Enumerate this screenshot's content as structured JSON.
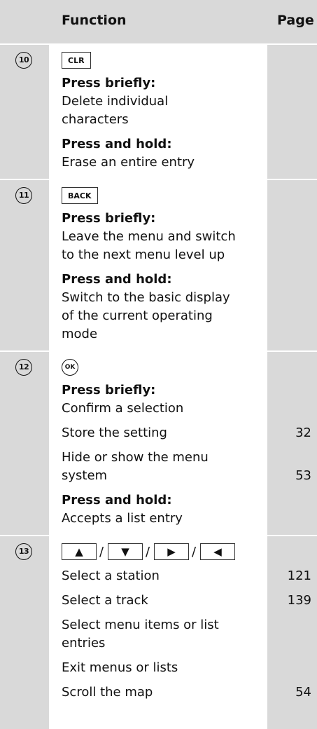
{
  "header": {
    "function": "Function",
    "page": "Page"
  },
  "rows": [
    {
      "number": "10",
      "key": "CLR",
      "press_briefly": "Press briefly:",
      "brief_l1": "Delete individual",
      "brief_l2": "characters",
      "press_hold": "Press and hold:",
      "hold_l1": "Erase an entire entry"
    },
    {
      "number": "11",
      "key": "BACK",
      "press_briefly": "Press briefly:",
      "brief_l1": "Leave the menu and switch",
      "brief_l2": "to the next menu level up",
      "press_hold": "Press and hold:",
      "hold_l1": "Switch to the basic display",
      "hold_l2": "of the current operating",
      "hold_l3": "mode"
    },
    {
      "number": "12",
      "key": "OK",
      "press_briefly": "Press briefly:",
      "items": [
        {
          "l1": "Confirm a selection"
        },
        {
          "l1": "Store the setting",
          "page": "32"
        },
        {
          "l1": "Hide or show the menu",
          "l2": "system",
          "page": "53"
        }
      ],
      "press_hold": "Press and hold:",
      "hold_l1": "Accepts a list entry"
    },
    {
      "number": "13",
      "keys": [
        "▲",
        "▼",
        "▶",
        "◀"
      ],
      "separator": "/",
      "items": [
        {
          "l1": "Select a station",
          "page": "121"
        },
        {
          "l1": "Select a track",
          "page": "139"
        },
        {
          "l1": "Select menu items or list",
          "l2": "entries"
        },
        {
          "l1": "Exit menus or lists"
        },
        {
          "l1": "Scroll the map",
          "page": "54"
        }
      ]
    }
  ]
}
